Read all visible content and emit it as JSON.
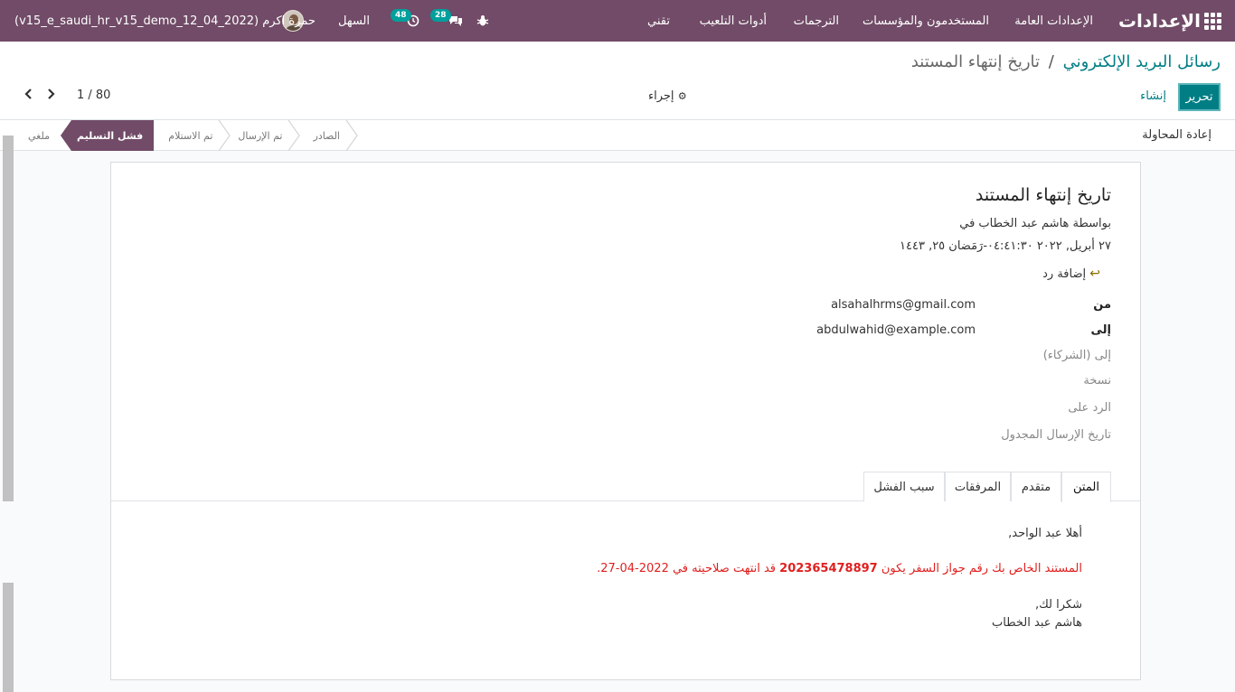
{
  "navbar": {
    "brand": "الإعدادات",
    "menu": [
      "الإعدادات العامة",
      "المستخدمون والمؤسسات",
      "الترجمات",
      "أدوات التلعيب",
      "تقني"
    ],
    "activities_count": "48",
    "messages_count": "28",
    "company": "السهل",
    "user": "حمزة اكرم (v15_e_saudi_hr_v15_demo_12_04_2022)"
  },
  "breadcrumb": {
    "parent": "رسائل البريد الإلكتروني",
    "separator": "/",
    "current": "تاريخ إنتهاء المستند"
  },
  "controls": {
    "edit_label": "تحرير",
    "create_label": "إنشاء",
    "action_label": "إجراء",
    "pager_value": "1 / 80"
  },
  "statusbar": {
    "retry_label": "إعادة المحاولة",
    "stages": [
      "الصادر",
      "تم الإرسال",
      "تم الاستلام",
      "فشل التسليم",
      "ملغي"
    ],
    "current_stage": "فشل التسليم"
  },
  "message": {
    "subject": "تاريخ إنتهاء المستند",
    "author_line": "بواسطة هاشم عبد الخطاب في",
    "date_line": "٢٧ أبريل, ٢٠٢٢ ٠٤:٤١:٣٠-رَمَضان ٢٥, ١٤٤٣",
    "reply_label": "إضافة رد",
    "from_label": "من",
    "from_value": "alsahalhrms@gmail.com",
    "to_label": "إلى",
    "to_value": "abdulwahid@example.com",
    "partners_label": "إلى (الشركاء)",
    "cc_label": "نسخة",
    "reply_to_label": "الرد على",
    "scheduled_label": "تاريخ الإرسال المجدول"
  },
  "tabs": [
    "المتن",
    "متقدم",
    "المرفقات",
    "سبب الفشل"
  ],
  "body": {
    "greeting": "أهلا عبد الواحد,",
    "alert_prefix": "المستند الخاص بك رقم جواز السفر يكون",
    "alert_number": "202365478897",
    "alert_suffix": "قد انتهت صلاحيته في 2022-04-27.",
    "thanks": "شكرا لك,",
    "signature": "هاشم عبد الخطاب"
  },
  "colors": {
    "navbar": "#714b67",
    "primary": "#017e84",
    "badge": "#00a09d",
    "alert_text": "#e0201f"
  }
}
